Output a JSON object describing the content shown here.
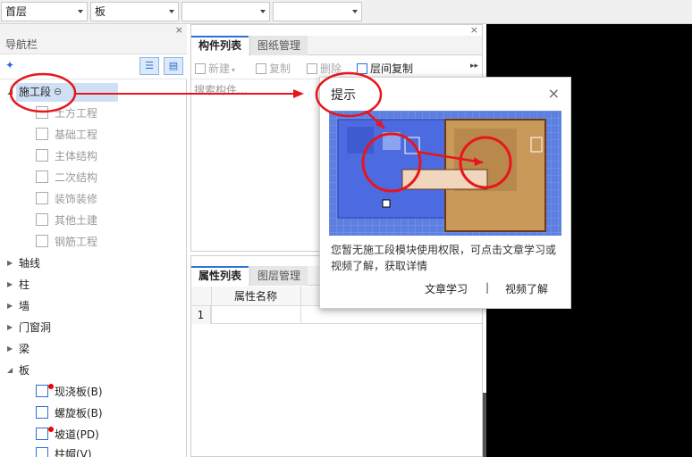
{
  "toolbar": {
    "floor_select": "首层",
    "category_select": "板",
    "select3": "",
    "select4": ""
  },
  "nav": {
    "title": "导航栏",
    "close": "×",
    "items": [
      {
        "label": "施工段",
        "expanded": true
      },
      {
        "label": "轴线"
      },
      {
        "label": "柱"
      },
      {
        "label": "墙"
      },
      {
        "label": "门窗洞"
      },
      {
        "label": "梁"
      },
      {
        "label": "板",
        "expanded": true
      }
    ],
    "construction_sub": [
      "土方工程",
      "基础工程",
      "主体结构",
      "二次结构",
      "装饰装修",
      "其他土建",
      "钢筋工程"
    ],
    "slab_sub": [
      "现浇板(B)",
      "螺旋板(B)",
      "坡道(PD)",
      "柱帽(V)"
    ]
  },
  "component_panel": {
    "tab_active": "构件列表",
    "tab_inactive": "图纸管理",
    "close": "×",
    "tools": {
      "new": "新建",
      "copy": "复制",
      "delete": "删除",
      "floor_copy": "层间复制"
    },
    "search_placeholder": "搜索构件..."
  },
  "property_panel": {
    "tab_active": "属性列表",
    "tab_inactive": "图层管理",
    "column": "属性名称",
    "row_number": "1"
  },
  "popup": {
    "title": "提示",
    "close": "×",
    "message": "您暂无施工段模块使用权限，可点击文章学习或视频了解，获取详情",
    "link_article": "文章学习",
    "separator": "|",
    "link_video": "视频了解"
  },
  "colors": {
    "accent": "#2a6fd6",
    "annotation_red": "#e8151b",
    "selection": "#cfe0f5"
  }
}
